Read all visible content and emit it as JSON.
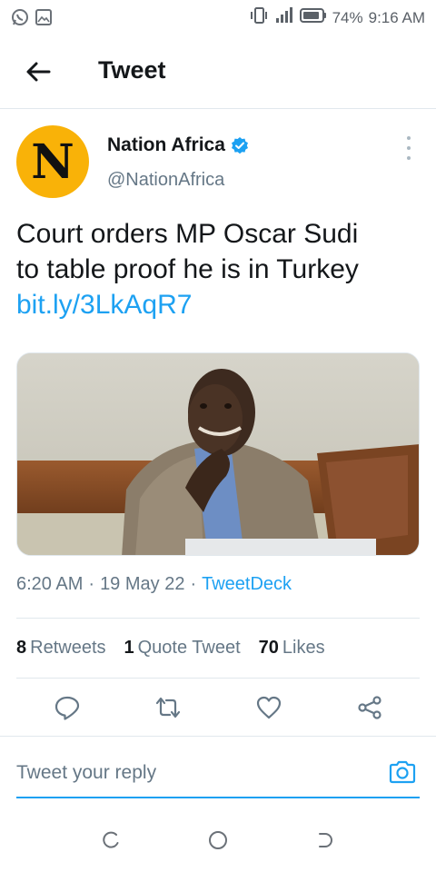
{
  "status_bar": {
    "battery": "74%",
    "time": "9:16 AM",
    "left_icons": [
      "whatsapp-icon",
      "image-icon"
    ],
    "right_icons": [
      "vibrate-icon",
      "signal-icon",
      "battery-icon"
    ]
  },
  "header": {
    "title": "Tweet",
    "back_icon": "arrow-left-icon"
  },
  "author": {
    "avatar_letter": "N",
    "name": "Nation Africa",
    "handle": "@NationAfrica",
    "verified": true
  },
  "tweet": {
    "text_line1": "Court orders MP Oscar Sudi",
    "text_line2": "to table proof he is in Turkey",
    "link": "bit.ly/3LkAqR7"
  },
  "meta": {
    "time": "6:20 AM",
    "sep1": "·",
    "date": "19 May 22",
    "sep2": "·",
    "source": "TweetDeck"
  },
  "stats": {
    "retweets_count": "8",
    "retweets_label": "Retweets",
    "quotes_count": "1",
    "quotes_label": "Quote Tweet",
    "likes_count": "70",
    "likes_label": "Likes"
  },
  "actions": [
    "reply-icon",
    "retweet-icon",
    "like-icon",
    "share-icon"
  ],
  "reply": {
    "placeholder": "Tweet your reply"
  },
  "colors": {
    "accent": "#1da1f2",
    "text": "#14171a",
    "muted": "#657786",
    "avatar_bg": "#f9b208"
  }
}
